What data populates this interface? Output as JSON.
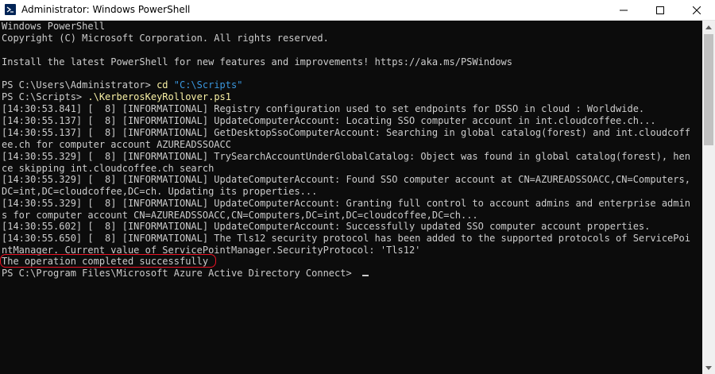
{
  "window": {
    "title": "Administrator: Windows PowerShell",
    "colors": {
      "background": "#0c0c0c",
      "text": "#cccccc",
      "command": "#f9f1a5",
      "string": "#3a96dd",
      "highlight": "#e81123"
    }
  },
  "icons": {
    "app": "powershell-icon",
    "minimize": "minimize-icon",
    "maximize": "maximize-icon",
    "close": "close-icon"
  },
  "console": {
    "lines": [
      "Windows PowerShell",
      "Copyright (C) Microsoft Corporation. All rights reserved.",
      "",
      "Install the latest PowerShell for new features and improvements! https://aka.ms/PSWindows",
      "",
      "PS C:\\Users\\Administrator> cd \"C:\\Scripts\"",
      "PS C:\\Scripts> .\\KerberosKeyRollover.ps1",
      "[14:30:53.841] [  8] [INFORMATIONAL] Registry configuration used to set endpoints for DSSO in cloud : Worldwide.",
      "[14:30:55.137] [  8] [INFORMATIONAL] UpdateComputerAccount: Locating SSO computer account in int.cloudcoffee.ch...",
      "[14:30:55.137] [  8] [INFORMATIONAL] GetDesktopSsoComputerAccount: Searching in global catalog(forest) and int.cloudcoff",
      "ee.ch for computer account AZUREADSSOACC",
      "[14:30:55.329] [  8] [INFORMATIONAL] TrySearchAccountUnderGlobalCatalog: Object was found in global catalog(forest), hen",
      "ce skipping int.cloudcoffee.ch search",
      "[14:30:55.329] [  8] [INFORMATIONAL] UpdateComputerAccount: Found SSO computer account at CN=AZUREADSSOACC,CN=Computers,",
      "DC=int,DC=cloudcoffee,DC=ch. Updating its properties...",
      "[14:30:55.329] [  8] [INFORMATIONAL] UpdateComputerAccount: Granting full control to account admins and enterprise admin",
      "s for computer account CN=AZUREADSSOACC,CN=Computers,DC=int,DC=cloudcoffee,DC=ch...",
      "[14:30:55.602] [  8] [INFORMATIONAL] UpdateComputerAccount: Successfully updated SSO computer account properties.",
      "[14:30:55.650] [  8] [INFORMATIONAL] The Tls12 security protocol has been added to the supported protocols of ServicePoi",
      "ntManager. Current value of ServicePointManager.SecurityProtocol: 'Tls12'",
      "The operation completed successfully",
      "PS C:\\Program Files\\Microsoft Azure Active Directory Connect> "
    ],
    "prompt1": "PS C:\\Users\\Administrator> ",
    "cmd1_verb": "cd",
    "cmd1_arg": " \"C:\\Scripts\"",
    "prompt2": "PS C:\\Scripts> ",
    "cmd2": ".\\KerberosKeyRollover.ps1"
  }
}
